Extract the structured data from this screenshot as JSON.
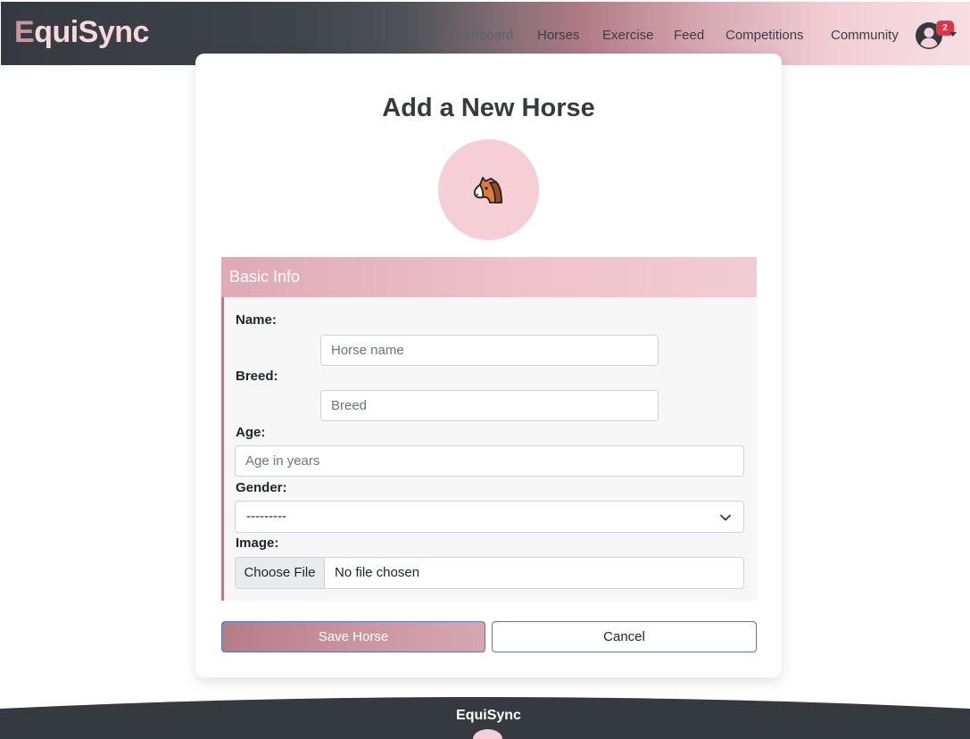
{
  "navbar": {
    "brand_initial": "E",
    "brand_rest": "quiSync",
    "links": [
      {
        "label": "Dashboard",
        "name": "nav-dashboard"
      },
      {
        "label": "Horses",
        "name": "nav-horses"
      },
      {
        "label": "Exercise",
        "name": "nav-exercise"
      },
      {
        "label": "Feed",
        "name": "nav-feed"
      },
      {
        "label": "Competitions",
        "name": "nav-competitions"
      },
      {
        "label": "Community",
        "name": "nav-community"
      }
    ],
    "notification_count": "2",
    "user_icon": "user-circle-icon"
  },
  "page": {
    "title": "Add a New Horse",
    "avatar_icon": "horse-face-icon"
  },
  "form": {
    "section_title": "Basic Info",
    "name_label": "Name:",
    "name_placeholder": "Horse name",
    "breed_label": "Breed:",
    "breed_placeholder": "Breed",
    "age_label": "Age:",
    "age_placeholder": "Age in years",
    "gender_label": "Gender:",
    "gender_selected": "---------",
    "image_label": "Image:",
    "choose_file_label": "Choose File",
    "file_status": "No file chosen",
    "save_label": "Save Horse",
    "cancel_label": "Cancel"
  },
  "footer": {
    "title": "EquiSync"
  },
  "colors": {
    "accent_pink": "#f5ced6",
    "accent_mauve": "#b57e88",
    "navbar_dark": "#343a40",
    "badge_red": "#dc3545"
  }
}
